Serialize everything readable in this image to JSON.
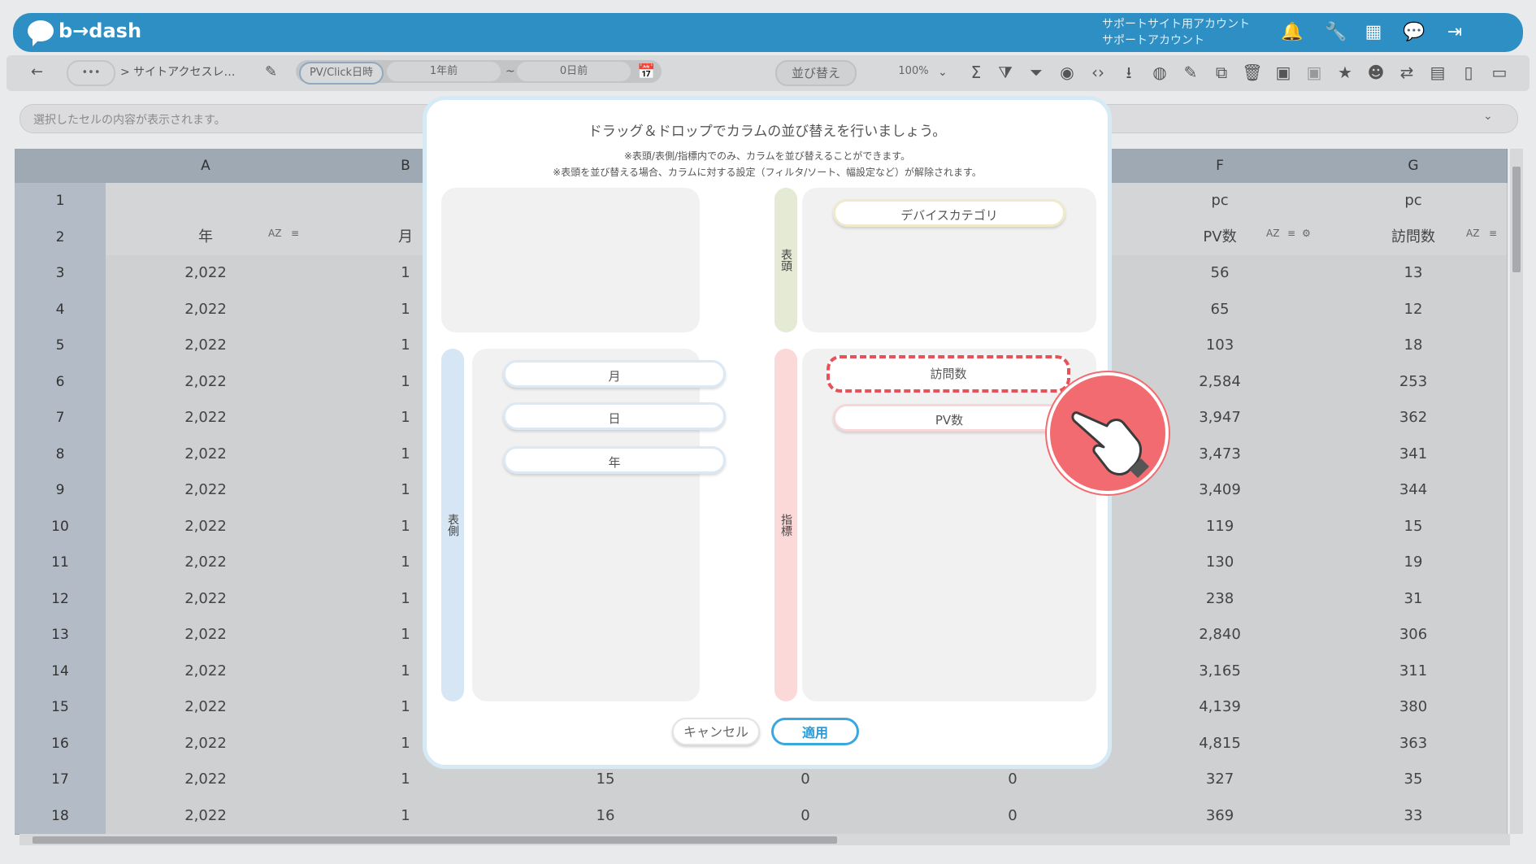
{
  "header": {
    "brand": "b→dash",
    "account_line1": "サポートサイト用アカウント",
    "account_line2": "サポートアカウント"
  },
  "toolbar": {
    "back": "←",
    "more": "•••",
    "breadcrumb": "> サイトアクセスレ…",
    "date_type": "PV/Click日時",
    "from": "1年前",
    "tilde": "~",
    "to": "0日前",
    "sort_button": "並び替え",
    "zoom": "100%"
  },
  "cell_bar": {
    "placeholder": "選択したセルの内容が表示されます。"
  },
  "sheet": {
    "columns": [
      "A",
      "B",
      "F",
      "G"
    ],
    "row1": {
      "F": "pc",
      "G": "pc"
    },
    "row2": {
      "A": "年",
      "B": "月",
      "F": "PV数",
      "G": "訪問数"
    },
    "rows": [
      {
        "n": "3",
        "A": "2,022",
        "B": "1",
        "F": "56",
        "G": "13"
      },
      {
        "n": "4",
        "A": "2,022",
        "B": "1",
        "F": "65",
        "G": "12"
      },
      {
        "n": "5",
        "A": "2,022",
        "B": "1",
        "F": "103",
        "G": "18"
      },
      {
        "n": "6",
        "A": "2,022",
        "B": "1",
        "F": "2,584",
        "G": "253"
      },
      {
        "n": "7",
        "A": "2,022",
        "B": "1",
        "F": "3,947",
        "G": "362"
      },
      {
        "n": "8",
        "A": "2,022",
        "B": "1",
        "F": "3,473",
        "G": "341"
      },
      {
        "n": "9",
        "A": "2,022",
        "B": "1",
        "F": "3,409",
        "G": "344"
      },
      {
        "n": "10",
        "A": "2,022",
        "B": "1",
        "F": "119",
        "G": "15"
      },
      {
        "n": "11",
        "A": "2,022",
        "B": "1",
        "F": "130",
        "G": "19"
      },
      {
        "n": "12",
        "A": "2,022",
        "B": "1",
        "F": "238",
        "G": "31"
      },
      {
        "n": "13",
        "A": "2,022",
        "B": "1",
        "F": "2,840",
        "G": "306"
      },
      {
        "n": "14",
        "A": "2,022",
        "B": "1",
        "F": "3,165",
        "G": "311"
      },
      {
        "n": "15",
        "A": "2,022",
        "B": "1",
        "F": "4,139",
        "G": "380"
      },
      {
        "n": "16",
        "A": "2,022",
        "B": "1",
        "F": "4,815",
        "G": "363"
      },
      {
        "n": "17",
        "A": "2,022",
        "B": "1",
        "C": "15",
        "D": "0",
        "E": "0",
        "F": "327",
        "G": "35"
      },
      {
        "n": "18",
        "A": "2,022",
        "B": "1",
        "C": "16",
        "D": "0",
        "E": "0",
        "F": "369",
        "G": "33"
      }
    ]
  },
  "modal": {
    "title": "ドラッグ＆ドロップでカラムの並び替えを行いましょう。",
    "note1": "※表頭/表側/指標内でのみ、カラムを並び替えることができます。",
    "note2": "※表頭を並び替える場合、カラムに対する設定（フィルタ/ソート、幅設定など）が解除されます。",
    "label_header": "表頭",
    "label_side": "表側",
    "label_metric": "指標",
    "header_items": [
      "デバイスカテゴリ"
    ],
    "side_items": [
      "月",
      "日",
      "年"
    ],
    "metric_items": [
      "訪問数",
      "PV数"
    ],
    "cancel": "キャンセル",
    "apply": "適用"
  }
}
